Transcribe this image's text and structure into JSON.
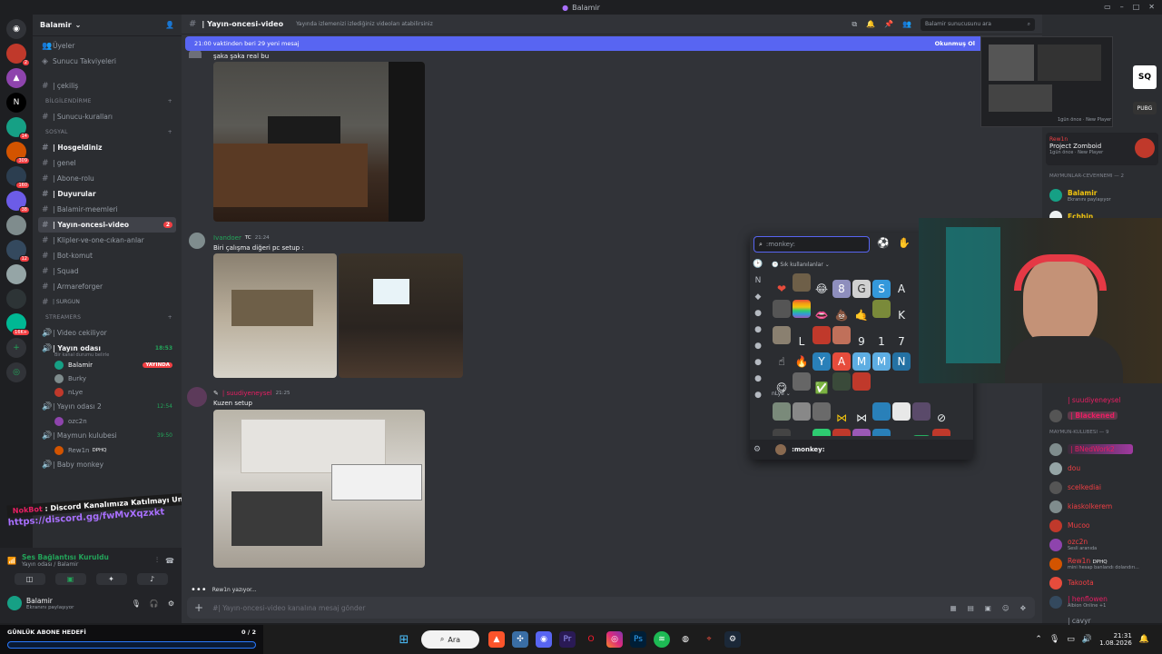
{
  "window": {
    "title": "Balamir"
  },
  "guild_badges": [
    "2",
    "14",
    "309",
    "160",
    "38",
    "12",
    "16K+"
  ],
  "server": {
    "name": "Balamir"
  },
  "top_items": [
    "Üyeler",
    "Sunucu Takviyeleri"
  ],
  "channels_top": [
    {
      "name": "| çekiliş"
    }
  ],
  "categories": {
    "bilgilendirme": "BİLGİLENDİRME",
    "sosyal": "SOSYAL",
    "streamers": "STREAMERS"
  },
  "channels_bilgi": [
    {
      "name": "| Sunucu-kuralları"
    }
  ],
  "channels_sosyal": [
    {
      "name": "| Hosgeldiniz",
      "bold": true
    },
    {
      "name": "| genel"
    },
    {
      "name": "| Abone-rolu"
    },
    {
      "name": "| Duyurular",
      "bold": true
    },
    {
      "name": "| Balamir-meemleri"
    },
    {
      "name": "| Yayın-oncesi-video",
      "selected": true,
      "badge": "2"
    },
    {
      "name": "| Klipler-ve-one-cıkan-anlar"
    },
    {
      "name": "| Bot-komut"
    },
    {
      "name": "| Squad"
    },
    {
      "name": "| Armareforger"
    },
    {
      "name": "| SURGUN"
    }
  ],
  "voice": {
    "video_cekiliyor": "| Video cekiliyor",
    "yayin_odasi": "| Yayın odası",
    "yayin_odasi_time": "18:53",
    "yayin_odasi_status": "Bir kanal durumu belirle",
    "users": [
      {
        "name": "Balamir",
        "tag": "YAYINDA"
      },
      {
        "name": "Burky"
      },
      {
        "name": "nLye"
      }
    ],
    "yayin_odasi2": "| Yayın odası 2",
    "yayin_odasi2_time": "12:54",
    "ozc": "ozc2n",
    "maymun": "| Maymun kulubesi",
    "maymun_time": "39:50",
    "rewin": "Rew1n",
    "rewin_tag": "DPHQ",
    "baby": "| Baby monkey"
  },
  "bot_overlay": {
    "label": "Discord Kanalımıza Katılmayı Unutma!",
    "link": "https://discord.gg/fwMvXqzxkt",
    "bot": "NokBot"
  },
  "voice_conn": {
    "status": "Ses Bağlantısı Kuruldu",
    "channel": "Yayın odası / Balamir"
  },
  "user": {
    "name": "Balamir",
    "status": "Ekranını paylaşıyor"
  },
  "channel_header": {
    "name": "| Yayın-oncesi-video",
    "topic": "Yayında izlemenizi izlediğiniz videoları atabilirsiniz",
    "search": "Balamir sunucusunu ara"
  },
  "new_bar": {
    "text": "21:00 vaktinden beri 29 yeni mesaj",
    "action": "Okunmuş Ol"
  },
  "messages": [
    {
      "text": "şaka şaka real bu"
    },
    {
      "user": "Ivandoer",
      "badge": "TC",
      "time": "21:24",
      "text": "Biri çalışma diğeri pc setup :"
    },
    {
      "user": "| suudiyeneysel",
      "time": "21:25",
      "text": "Kuzen setup"
    }
  ],
  "typing": "Rew1n yazıyor...",
  "composer": {
    "placeholder": "#| Yayın-oncesi-video kanalına mesaj gönder"
  },
  "picker": {
    "search_placeholder": ":monkey:",
    "frequent": "Sık kullanılanlar",
    "section2": "nLye",
    "footer": ":monkey:"
  },
  "members": {
    "game_card": {
      "user": "Rew1n",
      "game": "Project Zomboid",
      "detail": "1gün önce · New Player"
    },
    "preview_detail": "1gün önce · New Player",
    "cat1": "MAYMUNLAR-CEVEHNEMI — 2",
    "cat1_items": [
      {
        "name": "Balamir",
        "sub": "Ekranını paylaşıyor"
      },
      {
        "name": "Echhin"
      }
    ],
    "cat_mid_items": [
      {
        "name": "| suudiyeneysel"
      },
      {
        "name": "| Blackened"
      }
    ],
    "cat2": "MAYMUN-KULUBESI — 9",
    "cat2_items": [
      {
        "name": "| BNedWork2"
      },
      {
        "name": "dou"
      },
      {
        "name": "scelkediai"
      },
      {
        "name": "kiaskolkerem"
      },
      {
        "name": "Mucoo"
      },
      {
        "name": "ozc2n",
        "sub": "Sesli aranıda"
      },
      {
        "name": "Rew1n",
        "tag": "DPHQ",
        "sub": "mini hesap banlandı dolandırı..."
      },
      {
        "name": "Takoota"
      },
      {
        "name": "| henflowen",
        "sub": "Albion Online +1"
      },
      {
        "name": "| cavyr"
      }
    ]
  },
  "bottom_goal": {
    "label": "GÜNLÜK ABONE HEDEFİ",
    "value": "0 / 2",
    "progress": 0
  },
  "taskbar": {
    "search": "Ara",
    "time": "21:31",
    "date": "1.08.2026"
  },
  "colors": {
    "accent": "#5865f2",
    "online": "#23a55a",
    "danger": "#f23f43"
  }
}
